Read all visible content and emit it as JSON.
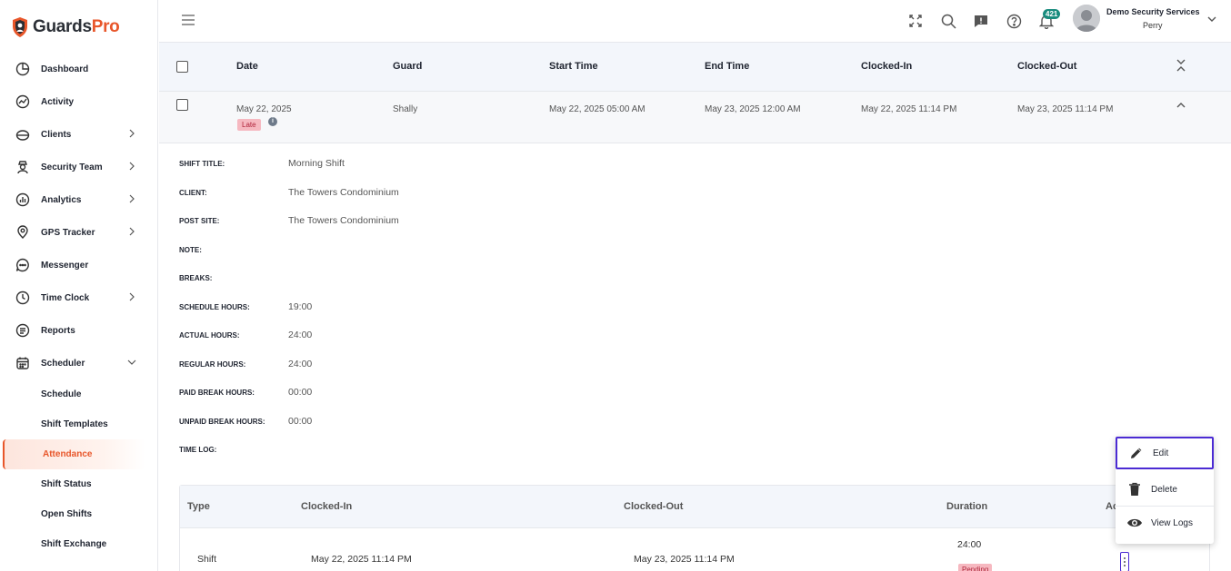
{
  "brand": {
    "part1": "Guards",
    "part2": "Pro",
    "accent": "#e8562a"
  },
  "sidebar": {
    "items": [
      {
        "label": "Dashboard",
        "icon": "dashboard-icon",
        "has_chevron": false
      },
      {
        "label": "Activity",
        "icon": "activity-icon",
        "has_chevron": false
      },
      {
        "label": "Clients",
        "icon": "clients-icon",
        "has_chevron": true
      },
      {
        "label": "Security Team",
        "icon": "security-team-icon",
        "has_chevron": true
      },
      {
        "label": "Analytics",
        "icon": "analytics-icon",
        "has_chevron": true
      },
      {
        "label": "GPS Tracker",
        "icon": "gps-tracker-icon",
        "has_chevron": true
      },
      {
        "label": "Messenger",
        "icon": "messenger-icon",
        "has_chevron": false
      },
      {
        "label": "Time Clock",
        "icon": "time-clock-icon",
        "has_chevron": true
      },
      {
        "label": "Reports",
        "icon": "reports-icon",
        "has_chevron": false
      },
      {
        "label": "Scheduler",
        "icon": "scheduler-icon",
        "has_chevron": true,
        "expanded": true
      }
    ],
    "scheduler_sub": [
      "Schedule",
      "Shift Templates",
      "Attendance",
      "Shift Status",
      "Open Shifts",
      "Shift Exchange"
    ],
    "active_sub": "Attendance"
  },
  "topbar": {
    "notification_count": "421",
    "user_company": "Demo Security Services",
    "user_name": "Perry"
  },
  "table": {
    "columns": [
      "Date",
      "Guard",
      "Start Time",
      "End Time",
      "Clocked-In",
      "Clocked-Out"
    ],
    "row": {
      "date": "May 22, 2025",
      "status_badge": "Late",
      "guard": "Shally",
      "start_time": "May 22, 2025 05:00 AM",
      "end_time": "May 23, 2025 12:00 AM",
      "clocked_in": "May 22, 2025 11:14 PM",
      "clocked_out": "May 23, 2025 11:14 PM"
    }
  },
  "details": [
    {
      "label": "SHIFT TITLE:",
      "value": "Morning Shift"
    },
    {
      "label": "CLIENT:",
      "value": "The Towers Condominium"
    },
    {
      "label": "POST SITE:",
      "value": "The Towers Condominium"
    },
    {
      "label": "NOTE:",
      "value": ""
    },
    {
      "label": "BREAKS:",
      "value": ""
    },
    {
      "label": "SCHEDULE HOURS:",
      "value": "19:00"
    },
    {
      "label": "ACTUAL HOURS:",
      "value": "24:00"
    },
    {
      "label": "REGULAR HOURS:",
      "value": "24:00"
    },
    {
      "label": "PAID BREAK HOURS:",
      "value": "00:00"
    },
    {
      "label": "UNPAID BREAK HOURS:",
      "value": "00:00"
    },
    {
      "label": "TIME LOG:",
      "value": ""
    }
  ],
  "timelog": {
    "columns": [
      "Type",
      "Clocked-In",
      "Clocked-Out",
      "Duration",
      "Ac"
    ],
    "row": {
      "type": "Shift",
      "clocked_in": "May 22, 2025 11:14 PM",
      "clocked_out": "May 23, 2025 11:14 PM",
      "duration": "24:00",
      "status": "Pending"
    }
  },
  "action_menu": {
    "items": [
      {
        "label": "Edit",
        "icon": "pencil-icon"
      },
      {
        "label": "Delete",
        "icon": "trash-icon"
      },
      {
        "label": "View Logs",
        "icon": "eye-icon"
      }
    ],
    "selected": "Edit"
  }
}
